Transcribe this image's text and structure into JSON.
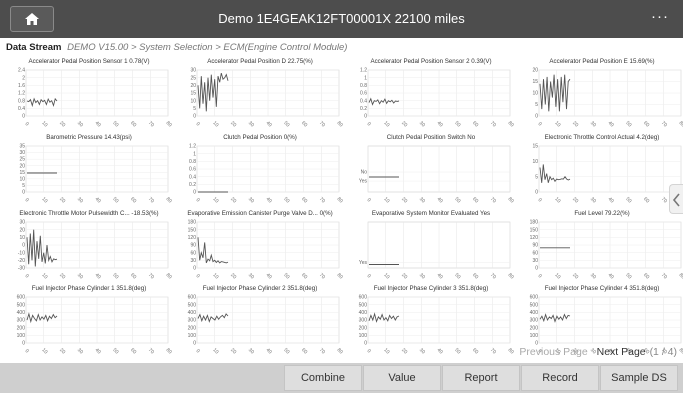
{
  "title": "Demo  1E4GEAK12FT00001X  22100 miles",
  "icons": {
    "home": "home-icon",
    "more": "more-icon",
    "collapse": "chevron-left-icon"
  },
  "more_label": "···",
  "breadcrumb": {
    "title": "Data Stream",
    "path": "DEMO V15.00 > System Selection > ECM(Engine Control Module)"
  },
  "colors": {
    "titlebar": "#4d4d4d",
    "line": "#555555",
    "bottombar": "#cfcfcf"
  },
  "x_ticks": [
    "0",
    "10",
    "20",
    "30",
    "40",
    "50",
    "60",
    "70",
    "80"
  ],
  "charts": [
    {
      "title": "Accelerator Pedal Position Sensor 1 0.78(V)",
      "y_ticks": [
        "2.4",
        "2",
        "1.6",
        "1.2",
        "0.8",
        "0.4",
        "0"
      ],
      "ymin": 0,
      "ymax": 2.4,
      "data": [
        0.78,
        0.75,
        0.85,
        0.55,
        0.9,
        0.7,
        0.8,
        0.6,
        0.85,
        0.75,
        0.82,
        0.6,
        0.88,
        0.72,
        0.8,
        0.55,
        0.9,
        0.78
      ]
    },
    {
      "title": "Accelerator Pedal Position D 22.75(%)",
      "y_ticks": [
        "30",
        "25",
        "20",
        "15",
        "10",
        "5",
        "0"
      ],
      "ymin": 0,
      "ymax": 30,
      "data": [
        20,
        5,
        26,
        8,
        22,
        3,
        25,
        10,
        27,
        12,
        24,
        6,
        26,
        22,
        28,
        24,
        25,
        27,
        23
      ]
    },
    {
      "title": "Accelerator Pedal Position Sensor 2 0.39(V)",
      "y_ticks": [
        "1.2",
        "1",
        "0.8",
        "0.6",
        "0.4",
        "0.2",
        "0"
      ],
      "ymin": 0,
      "ymax": 1.2,
      "data": [
        0.35,
        0.45,
        0.3,
        0.4,
        0.38,
        0.42,
        0.32,
        0.4,
        0.36,
        0.44,
        0.33,
        0.4,
        0.37,
        0.41,
        0.34,
        0.39,
        0.38,
        0.39
      ]
    },
    {
      "title": "Accelerator Pedal Position E 15.69(%)",
      "y_ticks": [
        "20",
        "15",
        "10",
        "5",
        "0"
      ],
      "ymin": 0,
      "ymax": 20,
      "data": [
        14,
        3,
        16,
        5,
        17,
        2,
        15,
        8,
        18,
        4,
        16,
        2,
        17,
        6,
        18,
        3,
        15,
        16
      ]
    },
    {
      "title": "Barometric Pressure 14.43(psi)",
      "y_ticks": [
        "35",
        "30",
        "25",
        "20",
        "15",
        "10",
        "5",
        "0"
      ],
      "ymin": 0,
      "ymax": 35,
      "data": [
        14.43,
        14.43,
        14.43,
        14.43,
        14.43,
        14.43,
        14.43,
        14.43,
        14.43,
        14.43,
        14.43,
        14.43,
        14.43,
        14.43,
        14.43,
        14.43,
        14.43,
        14.43,
        14.43,
        14.43,
        14.43
      ]
    },
    {
      "title": "Clutch Pedal Position 0(%)",
      "y_ticks": [
        "1.2",
        "1",
        "0.8",
        "0.6",
        "0.4",
        "0.2",
        "0"
      ],
      "ymin": 0,
      "ymax": 1.2,
      "data": [
        0,
        0,
        0,
        0,
        0,
        0,
        0,
        0,
        0,
        0,
        0,
        0,
        0,
        0,
        0,
        0,
        0,
        0,
        0,
        0,
        0
      ]
    },
    {
      "title": "Clutch Pedal Position Switch No",
      "y_ticks": [
        "No",
        "Yes"
      ],
      "ymin": 0,
      "ymax": 4,
      "data": [
        1.3,
        1.3,
        1.3,
        1.3,
        1.3,
        1.3,
        1.3,
        1.3,
        1.3,
        1.3,
        1.3,
        1.3,
        1.3,
        1.3,
        1.3,
        1.3,
        1.3,
        1.3,
        1.3,
        1.3
      ]
    },
    {
      "title": "Electronic Throttle Control Actual 4.2(deg)",
      "y_ticks": [
        "15",
        "10",
        "5",
        "0"
      ],
      "ymin": 0,
      "ymax": 15,
      "data": [
        8,
        3,
        9,
        4,
        6,
        3,
        5,
        4,
        4.5,
        3.5,
        4.2,
        4,
        4.1,
        4.3,
        4.2,
        5,
        4.2,
        3.9,
        4.2
      ]
    },
    {
      "title": "Electronic Throttle Motor Pulsewidth C... -18.53(%)",
      "y_ticks": [
        "30",
        "20",
        "10",
        "0",
        "-10",
        "-20",
        "-30"
      ],
      "ymin": -30,
      "ymax": 30,
      "data": [
        10,
        -25,
        15,
        -20,
        20,
        -28,
        5,
        -18,
        12,
        -22,
        -10,
        -24,
        0,
        -20,
        -15,
        -22,
        -18,
        -19,
        -18.53
      ]
    },
    {
      "title": "Evaporative Emission Canister Purge Valve D... 0(%)",
      "y_ticks": [
        "180",
        "150",
        "120",
        "90",
        "60",
        "30",
        "0"
      ],
      "ymin": 0,
      "ymax": 180,
      "data": [
        120,
        30,
        60,
        40,
        100,
        20,
        35,
        28,
        50,
        25,
        30,
        22,
        28,
        20,
        25,
        24,
        22,
        20,
        23
      ]
    },
    {
      "title": "Evaporative System Monitor Evaluated Yes",
      "y_ticks": [
        "Yes"
      ],
      "ymin": 0,
      "ymax": 4,
      "data": [
        0.3,
        0.3,
        0.3,
        0.3,
        0.3,
        0.3,
        0.3,
        0.3,
        0.3,
        0.3,
        0.3,
        0.3,
        0.3,
        0.3,
        0.3,
        0.3,
        0.3,
        0.3,
        0.3,
        0.3,
        0.3
      ]
    },
    {
      "title": "Fuel Level 79.22(%)",
      "y_ticks": [
        "180",
        "150",
        "120",
        "90",
        "60",
        "30",
        "0"
      ],
      "ymin": 0,
      "ymax": 180,
      "data": [
        79.22,
        79.22,
        79.22,
        79.22,
        79.22,
        79.22,
        79.22,
        79.22,
        79.22,
        79.22,
        79.22,
        79.22,
        79.22,
        79.22,
        79.22,
        79.22,
        79.22,
        79.22,
        79.22,
        79.22,
        79.22
      ]
    },
    {
      "title": "Fuel Injector Phase Cylinder 1 351.8(deg)",
      "y_ticks": [
        "600",
        "500",
        "400",
        "300",
        "200",
        "100",
        "0"
      ],
      "ymin": 0,
      "ymax": 600,
      "data": [
        300,
        380,
        280,
        360,
        320,
        290,
        370,
        300,
        340,
        310,
        360,
        290,
        350,
        320,
        370,
        330,
        351.8
      ]
    },
    {
      "title": "Fuel Injector Phase Cylinder 2 351.8(deg)",
      "y_ticks": [
        "600",
        "500",
        "400",
        "300",
        "200",
        "100",
        "0"
      ],
      "ymin": 0,
      "ymax": 600,
      "data": [
        320,
        370,
        290,
        350,
        300,
        360,
        280,
        340,
        320,
        300,
        350,
        310,
        340,
        360,
        330,
        380,
        351.8
      ]
    },
    {
      "title": "Fuel Injector Phase Cylinder 3 351.8(deg)",
      "y_ticks": [
        "600",
        "500",
        "400",
        "300",
        "200",
        "100",
        "0"
      ],
      "ymin": 0,
      "ymax": 600,
      "data": [
        290,
        360,
        300,
        380,
        280,
        340,
        310,
        370,
        300,
        330,
        290,
        360,
        320,
        350,
        300,
        340,
        351.8
      ]
    },
    {
      "title": "Fuel Injector Phase Cylinder 4 351.8(deg)",
      "y_ticks": [
        "600",
        "500",
        "400",
        "300",
        "200",
        "100",
        "0"
      ],
      "ymin": 0,
      "ymax": 600,
      "data": [
        310,
        350,
        290,
        370,
        300,
        340,
        320,
        360,
        280,
        350,
        310,
        340,
        300,
        370,
        320,
        360,
        351.8
      ]
    }
  ],
  "pager": {
    "prev": "Previous Page",
    "next": "Next Page",
    "count": "(1 / 4)"
  },
  "buttons": [
    "Combine",
    "Value",
    "Report",
    "Record",
    "Sample DS"
  ]
}
